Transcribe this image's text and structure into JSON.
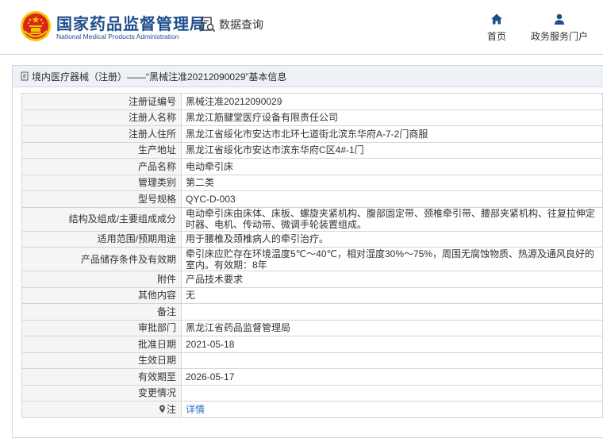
{
  "header": {
    "org_cn": "国家药品监督管理局",
    "org_en": "National Medical Products Administration",
    "query_label": "数据查询",
    "home_label": "首页",
    "service_label": "政务服务门户"
  },
  "panel": {
    "title": "境内医疗器械（注册）——“黑械注准20212090029”基本信息"
  },
  "rows": [
    {
      "key": "注册证编号",
      "value": "黑械注准20212090029"
    },
    {
      "key": "注册人名称",
      "value": "黑龙江筋腱堂医疗设备有限责任公司"
    },
    {
      "key": "注册人住所",
      "value": "黑龙江省绥化市安达市北环七道街北滨东华府A-7-2门商服"
    },
    {
      "key": "生产地址",
      "value": "黑龙江省绥化市安达市滨东华府C区4#-1门"
    },
    {
      "key": "产品名称",
      "value": "电动牵引床"
    },
    {
      "key": "管理类别",
      "value": "第二类"
    },
    {
      "key": "型号规格",
      "value": "QYC-D-003"
    },
    {
      "key": "结构及组成/主要组成成分",
      "value": "电动牵引床由床体、床板、螺旋夹紧机构、腹部固定带、颈椎牵引带、腰部夹紧机构、往复拉伸定时器、电机、传动带、微调手轮装置组成。"
    },
    {
      "key": "适用范围/预期用途",
      "value": "用于腰椎及颈椎病人的牵引治疗。"
    },
    {
      "key": "产品储存条件及有效期",
      "value": "牵引床应贮存在环境温度5℃～40℃，相对湿度30%～75%，周围无腐蚀物质、热源及通风良好的室内。有效期：8年"
    },
    {
      "key": "附件",
      "value": "产品技术要求"
    },
    {
      "key": "其他内容",
      "value": "无"
    },
    {
      "key": "备注",
      "value": ""
    },
    {
      "key": "审批部门",
      "value": "黑龙江省药品监督管理局"
    },
    {
      "key": "批准日期",
      "value": "2021-05-18"
    },
    {
      "key": "生效日期",
      "value": ""
    },
    {
      "key": "有效期至",
      "value": "2026-05-17"
    },
    {
      "key": "变更情况",
      "value": ""
    },
    {
      "key": "注",
      "value": "详情"
    }
  ],
  "colors": {
    "brand_blue": "#1f4e8c",
    "emblem_red": "#d9261c",
    "emblem_gold": "#f5c400",
    "link_blue": "#2f6fc1"
  },
  "icons": [
    "national-emblem-icon",
    "search-doc-icon",
    "home-icon",
    "user-icon",
    "document-icon",
    "pin-icon"
  ]
}
